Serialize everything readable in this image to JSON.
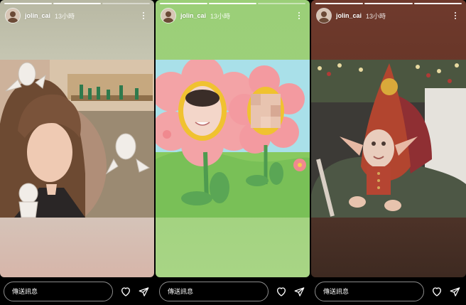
{
  "stories": [
    {
      "username": "jolin_cai",
      "time": "13小時",
      "message_placeholder": "傳送訊息",
      "colors": {
        "top": "#b8b8a3",
        "bottom": "#d7b5a9"
      }
    },
    {
      "username": "jolin_cai",
      "time": "13小時",
      "message_placeholder": "傳送訊息",
      "colors": {
        "top": "#9bcf78",
        "bottom": "#a8d585"
      }
    },
    {
      "username": "jolin_cai",
      "time": "13小時",
      "message_placeholder": "傳送訊息",
      "colors": {
        "top": "#6f3a2d",
        "bottom": "#3e2a21"
      }
    }
  ],
  "icons": [
    "more-options-icon",
    "heart-icon",
    "send-icon",
    "avatar-icon"
  ]
}
